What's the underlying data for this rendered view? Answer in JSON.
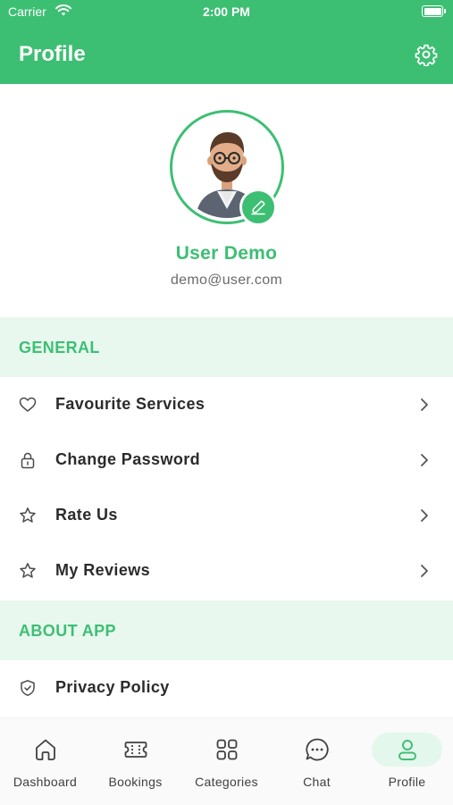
{
  "status_bar": {
    "carrier": "Carrier",
    "time": "2:00 PM"
  },
  "header": {
    "title": "Profile"
  },
  "profile": {
    "name": "User Demo",
    "email": "demo@user.com"
  },
  "sections": {
    "general": {
      "title": "GENERAL",
      "items": [
        {
          "label": "Favourite Services",
          "icon": "heart-icon"
        },
        {
          "label": "Change Password",
          "icon": "lock-icon"
        },
        {
          "label": "Rate Us",
          "icon": "star-icon"
        },
        {
          "label": "My Reviews",
          "icon": "star-icon"
        }
      ]
    },
    "about": {
      "title": "ABOUT APP",
      "items": [
        {
          "label": "Privacy Policy",
          "icon": "shield-check-icon"
        }
      ]
    }
  },
  "tabs": [
    {
      "label": "Dashboard",
      "icon": "home-icon"
    },
    {
      "label": "Bookings",
      "icon": "ticket-icon"
    },
    {
      "label": "Categories",
      "icon": "grid-icon"
    },
    {
      "label": "Chat",
      "icon": "chat-bubble-icon"
    },
    {
      "label": "Profile",
      "icon": "user-icon",
      "active": true
    }
  ],
  "colors": {
    "accent": "#3dbf73",
    "section_bg": "#e8f8ef",
    "text": "#2b2b2b"
  }
}
